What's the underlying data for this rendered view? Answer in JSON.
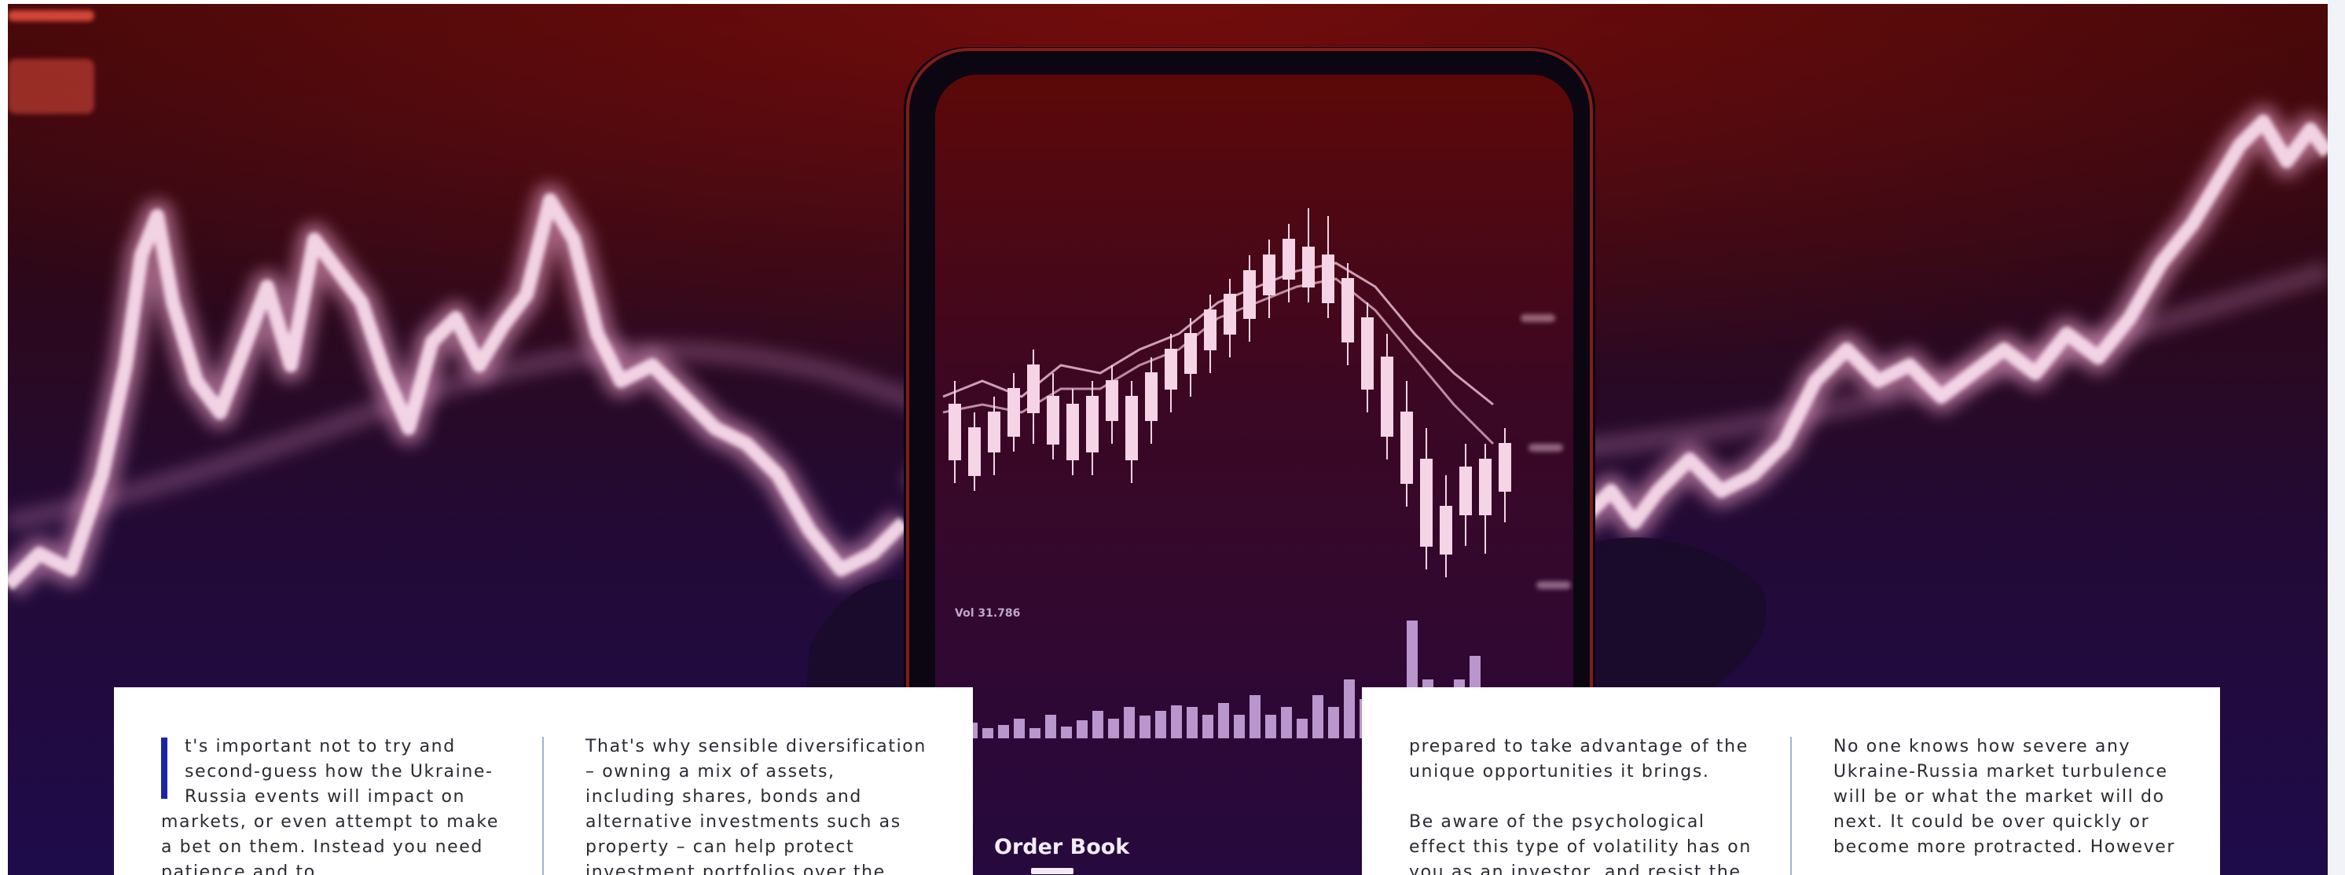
{
  "article": {
    "col1": {
      "text": "t's important not to try and second-guess how the Ukraine-Russia events will impact on markets, or even attempt to make a bet on them. Instead you need patience and to"
    },
    "col2": {
      "text": "That's why sensible diversification – owning a mix of assets, including shares, bonds and alternative investments such as property – can help protect investment portfolios over the"
    },
    "col3": {
      "p1": "prepared to take advantage of the unique opportunities it brings.",
      "p2": "Be aware of the psychological effect this type of volatility has on you as an investor, and resist the"
    },
    "col4": {
      "text": "No one knows how severe any Ukraine-Russia market turbulence will be or what the market will do next. It could be over quickly or become more protracted. However"
    }
  },
  "hero": {
    "phone_labels": {
      "volume": "Vol 31.786",
      "order_book": "Order Book"
    },
    "colors": {
      "dropcap": "#1d24a8",
      "divider": "#aab0cf",
      "glow": "#f6c7e3"
    }
  }
}
